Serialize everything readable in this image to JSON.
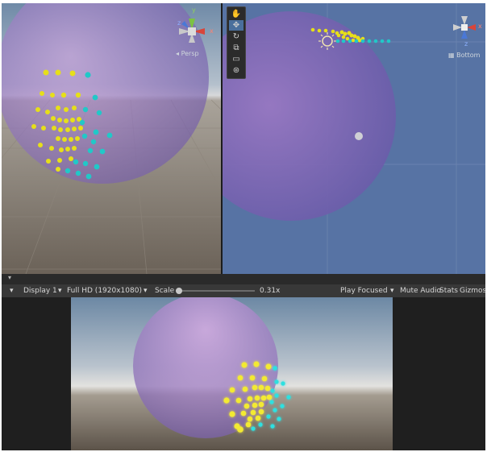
{
  "scene_view_left": {
    "camera_label": "Persp",
    "gizmo_axes": {
      "y": "y",
      "x": "x",
      "z": "z"
    }
  },
  "scene_view_right": {
    "camera_label": "Bottom",
    "gizmo_axes": {
      "z": "z",
      "x": "x"
    },
    "tools": [
      "hand-icon",
      "move-icon",
      "rotate-icon",
      "scale-icon",
      "rect-icon",
      "transform-icon"
    ]
  },
  "game_toolbar": {
    "display": "Display 1",
    "resolution": "Full HD (1920x1080)",
    "scale_label": "Scale",
    "scale_value": "0.31x",
    "play_mode": "Play Focused",
    "mute": "Mute Audio",
    "stats": "Stats",
    "gizmos": "Gizmos"
  },
  "colors": {
    "sphere": "#8a6fc0",
    "yellow_points": "#e6df1a",
    "cyan_points": "#21c8c8",
    "toolbar_bg": "#383838"
  }
}
